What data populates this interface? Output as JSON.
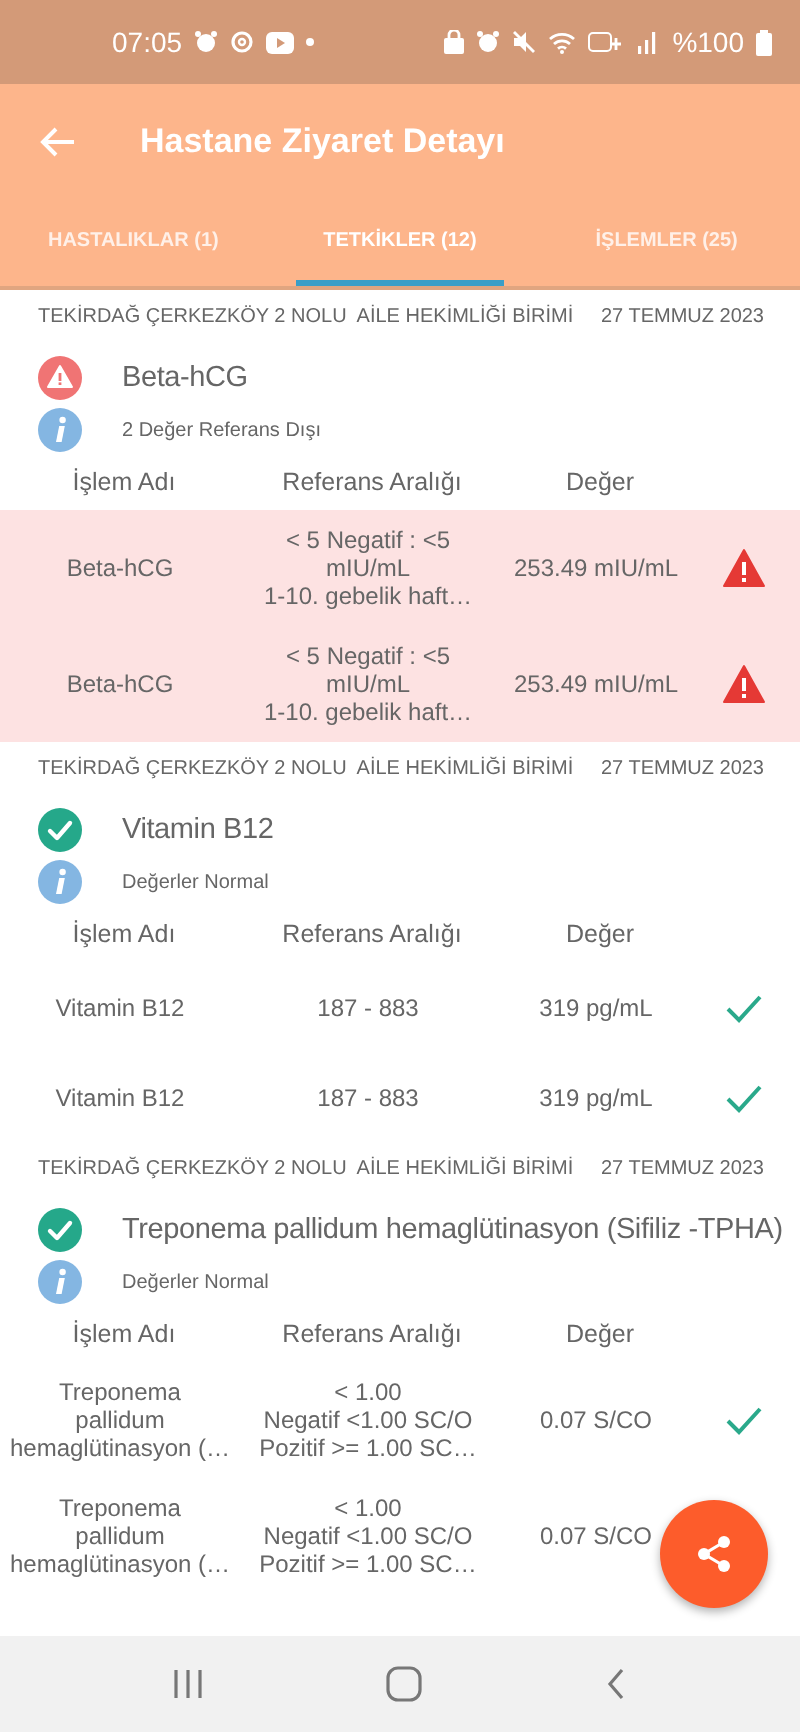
{
  "status_bar": {
    "time": "07:05",
    "battery": "%100"
  },
  "app_bar": {
    "title": "Hastane Ziyaret Detayı"
  },
  "tabs": [
    {
      "label": "HASTALIKLAR (1)",
      "selected": false
    },
    {
      "label": "TETKİKLER (12)",
      "selected": true
    },
    {
      "label": "İŞLEMLER (25)",
      "selected": false
    }
  ],
  "groups": [
    {
      "facility": "TEKİRDAĞ ÇERKEZKÖY 2 NOLU  AİLE HEKİMLİĞİ BİRİMİ",
      "date": "27 TEMMUZ 2023",
      "out_of_range": true,
      "test_name": "Beta-hCG",
      "summary": "2 Değer Referans Dışı",
      "columns": [
        "İşlem Adı",
        "Referans Aralığı",
        "Değer"
      ],
      "rows": [
        {
          "name": "Beta-hCG",
          "reference": "< 5 Negatif : <5\nmIU/mL\n1-10.   gebelik haft…",
          "value": "253.49 mIU/mL",
          "out_of_range": true
        },
        {
          "name": "Beta-hCG",
          "reference": "< 5 Negatif : <5\nmIU/mL\n1-10.   gebelik haft…",
          "value": "253.49 mIU/mL",
          "out_of_range": true
        }
      ]
    },
    {
      "facility": "TEKİRDAĞ ÇERKEZKÖY 2 NOLU  AİLE HEKİMLİĞİ BİRİMİ",
      "date": "27 TEMMUZ 2023",
      "out_of_range": false,
      "test_name": "Vitamin B12",
      "summary": "Değerler Normal",
      "columns": [
        "İşlem Adı",
        "Referans Aralığı",
        "Değer"
      ],
      "rows": [
        {
          "name": "Vitamin B12",
          "reference": "187 - 883",
          "value": "319 pg/mL",
          "out_of_range": false
        },
        {
          "name": "Vitamin B12",
          "reference": "187 - 883",
          "value": "319 pg/mL",
          "out_of_range": false
        }
      ]
    },
    {
      "facility": "TEKİRDAĞ ÇERKEZKÖY 2 NOLU  AİLE HEKİMLİĞİ BİRİMİ",
      "date": "27 TEMMUZ 2023",
      "out_of_range": false,
      "test_name": "Treponema pallidum hemaglütinasyon (Sifiliz -TPHA)",
      "summary": "Değerler Normal",
      "columns": [
        "İşlem Adı",
        "Referans Aralığı",
        "Değer"
      ],
      "rows": [
        {
          "name": "Treponema\npallidum\nhemaglütinasyon (…",
          "reference": "< 1.00\nNegatif <1.00  SC/O\nPozitif >= 1.00  SC…",
          "value": "0.07 S/CO",
          "out_of_range": false
        },
        {
          "name": "Treponema\npallidum\nhemaglütinasyon (…",
          "reference": "< 1.00\nNegatif <1.00  SC/O\nPozitif >= 1.00  SC…",
          "value": "0.07 S/CO"
        }
      ]
    }
  ]
}
